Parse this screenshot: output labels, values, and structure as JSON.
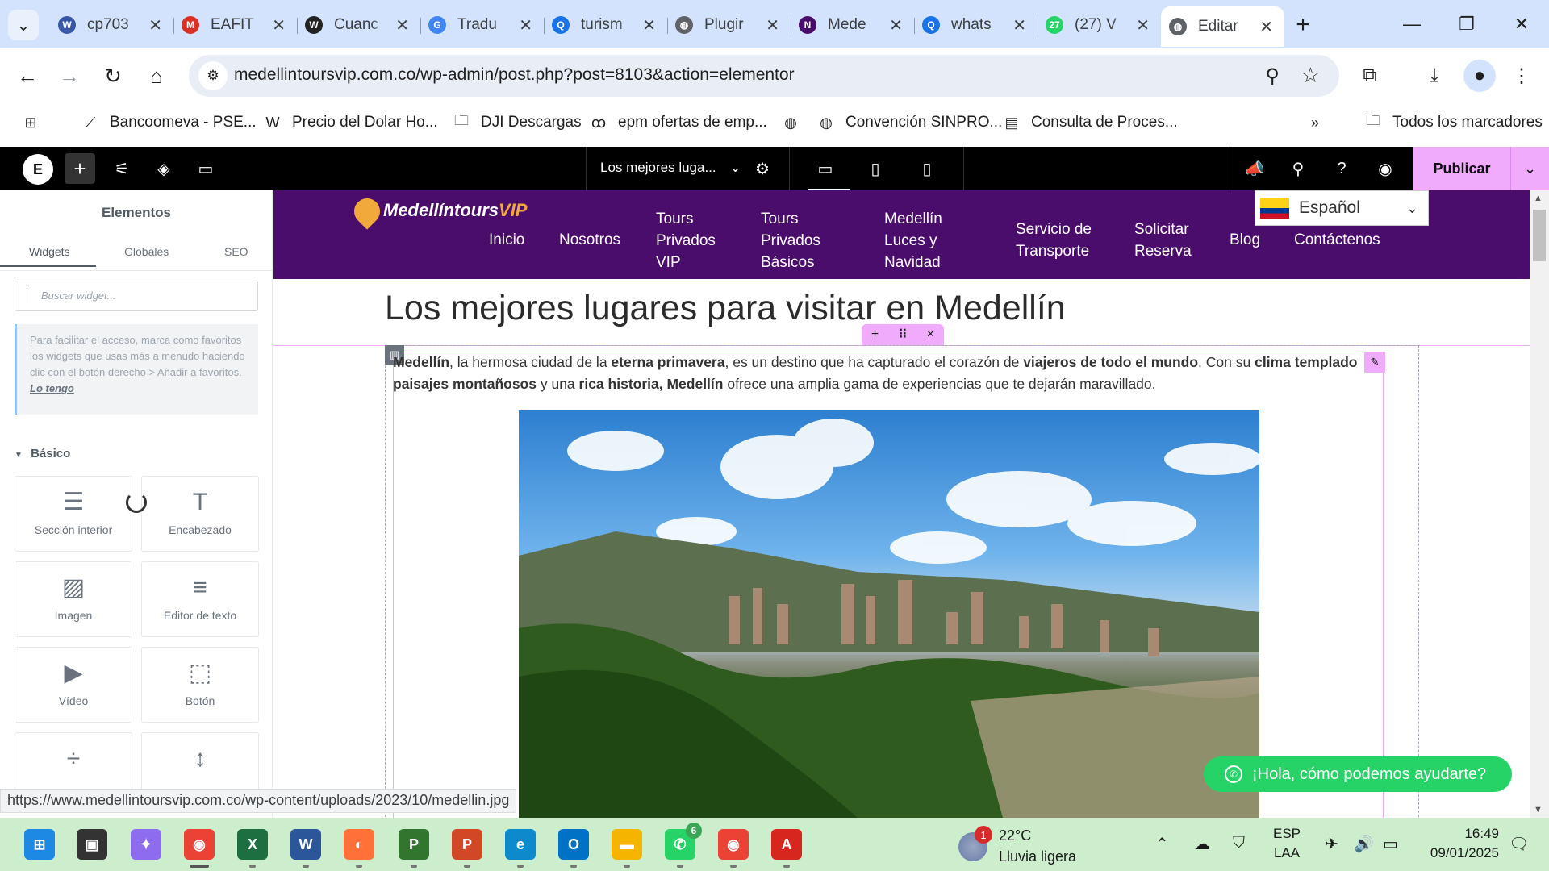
{
  "browser": {
    "tabs": [
      {
        "title": "cp703",
        "icon": "wp-icon",
        "color": "#3858a7",
        "glyph": "W"
      },
      {
        "title": "EAFIT",
        "icon": "gmail-icon",
        "color": "#d93025",
        "glyph": "M"
      },
      {
        "title": "Cuanc",
        "icon": "wp-dark-icon",
        "color": "#222",
        "glyph": "W"
      },
      {
        "title": "Tradu",
        "icon": "translate-icon",
        "color": "#4285f4",
        "glyph": "G"
      },
      {
        "title": "turism",
        "icon": "search-icon",
        "color": "#1a73e8",
        "glyph": "Q"
      },
      {
        "title": "Plugir",
        "icon": "globe-icon",
        "color": "#5f6368",
        "glyph": "◍"
      },
      {
        "title": "Mede",
        "icon": "site-logo-icon",
        "color": "#4b0d6b",
        "glyph": "N"
      },
      {
        "title": "whats",
        "icon": "search-icon",
        "color": "#1a73e8",
        "glyph": "Q"
      },
      {
        "title": "(27) V",
        "icon": "whatsapp-icon",
        "color": "#25d366",
        "glyph": "27"
      },
      {
        "title": "Editar",
        "icon": "globe-icon",
        "color": "#5f6368",
        "glyph": "◍",
        "active": true
      }
    ],
    "url": "medellintoursvip.com.co/wp-admin/post.php?post=8103&action=elementor",
    "bookmarks": [
      {
        "label": "Bancoomeva - PSE...",
        "icon": "bancoomeva-icon"
      },
      {
        "label": "Precio del Dolar Ho...",
        "icon": "w-icon"
      },
      {
        "label": "DJI Descargas",
        "icon": "folder-icon"
      },
      {
        "label": "epm ofertas de emp...",
        "icon": "epm-icon"
      },
      {
        "label": "",
        "icon": "globe-icon"
      },
      {
        "label": "Convención SINPRO...",
        "icon": "globe-icon"
      },
      {
        "label": "Consulta de Proces...",
        "icon": "doc-icon"
      }
    ],
    "all_bookmarks": "Todos los marcadores",
    "status_url": "https://www.medellintoursvip.com.co/wp-content/uploads/2023/10/medellin.jpg"
  },
  "elementor": {
    "doc_title": "Los mejores luga...",
    "publish": "Publicar",
    "panel": {
      "title": "Elementos",
      "tabs": [
        "Widgets",
        "Globales",
        "SEO"
      ],
      "search_placeholder": "Buscar widget...",
      "fav_note": "Para facilitar el acceso, marca como favoritos los widgets que usas más a menudo haciendo clic con el botón derecho > Añadir a favoritos.",
      "fav_link": "Lo tengo",
      "category": "Básico",
      "widgets": [
        {
          "label": "Sección interior",
          "icon": "inner-section-icon",
          "glyph": "☰"
        },
        {
          "label": "Encabezado",
          "icon": "heading-icon",
          "glyph": "T"
        },
        {
          "label": "Imagen",
          "icon": "image-icon",
          "glyph": "▨"
        },
        {
          "label": "Editor de texto",
          "icon": "text-editor-icon",
          "glyph": "≡"
        },
        {
          "label": "Vídeo",
          "icon": "video-icon",
          "glyph": "▶"
        },
        {
          "label": "Botón",
          "icon": "button-icon",
          "glyph": "⬚"
        },
        {
          "label": "",
          "icon": "divider-icon",
          "glyph": "÷"
        },
        {
          "label": "",
          "icon": "spacer-icon",
          "glyph": "↕"
        }
      ]
    }
  },
  "site": {
    "logo_main": "Medellíntours",
    "logo_vip": "VIP",
    "nav": [
      "Inicio",
      "Nosotros",
      "Tours\nPrivados\nVIP",
      "Tours\nPrivados\nBásicos",
      "Medellín\nLuces y\nNavidad",
      "Servicio de\nTransporte",
      "Solicitar\nReserva",
      "Blog",
      "Contáctenos"
    ],
    "language": "Español",
    "page_title": "Los mejores lugares para visitar en Medellín",
    "intro_line1": [
      {
        "t": "Medellín",
        "b": true
      },
      {
        "t": ", la hermosa ciudad de la ",
        "b": false
      },
      {
        "t": "eterna primavera",
        "b": true
      },
      {
        "t": ", es un destino que ha capturado el corazón de ",
        "b": false
      },
      {
        "t": "viajeros de todo el mundo",
        "b": true
      },
      {
        "t": ". Con su ",
        "b": false
      },
      {
        "t": "clima templado",
        "b": true
      }
    ],
    "intro_line2": [
      {
        "t": "paisajes montañosos",
        "b": true
      },
      {
        "t": " y una ",
        "b": false
      },
      {
        "t": "rica historia, Medellín",
        "b": true
      },
      {
        "t": " ofrece una amplia gama de experiencias que te dejarán maravillado.",
        "b": false
      }
    ],
    "whatsapp": "¡Hola, cómo podemos ayudarte?"
  },
  "taskbar": {
    "apps": [
      {
        "name": "start-button",
        "color": "#1e88e5",
        "glyph": "⊞"
      },
      {
        "name": "task-view",
        "color": "#333",
        "glyph": "▣"
      },
      {
        "name": "copilot",
        "color": "#8e6cef",
        "glyph": "✦"
      },
      {
        "name": "chrome",
        "color": "#ea4335",
        "glyph": "◉",
        "active": true
      },
      {
        "name": "excel",
        "color": "#1d6f42",
        "glyph": "X"
      },
      {
        "name": "word",
        "color": "#2b579a",
        "glyph": "W"
      },
      {
        "name": "firefox",
        "color": "#ff7139",
        "glyph": "◐"
      },
      {
        "name": "project",
        "color": "#31752f",
        "glyph": "P"
      },
      {
        "name": "powerpoint",
        "color": "#d24726",
        "glyph": "P"
      },
      {
        "name": "edge",
        "color": "#0c8acc",
        "glyph": "e"
      },
      {
        "name": "outlook",
        "color": "#0072c6",
        "glyph": "O"
      },
      {
        "name": "file-explorer",
        "color": "#f4b400",
        "glyph": "▬"
      },
      {
        "name": "whatsapp",
        "color": "#25d366",
        "glyph": "✆",
        "badge": "6"
      },
      {
        "name": "chrome-profile",
        "color": "#ea4335",
        "glyph": "◉"
      },
      {
        "name": "acrobat",
        "color": "#d7261e",
        "glyph": "A"
      }
    ],
    "weather_alert": "1",
    "temperature": "22°C",
    "condition": "Lluvia ligera",
    "lang_top": "ESP",
    "lang_bottom": "LAA",
    "time": "16:49",
    "date": "09/01/2025"
  }
}
